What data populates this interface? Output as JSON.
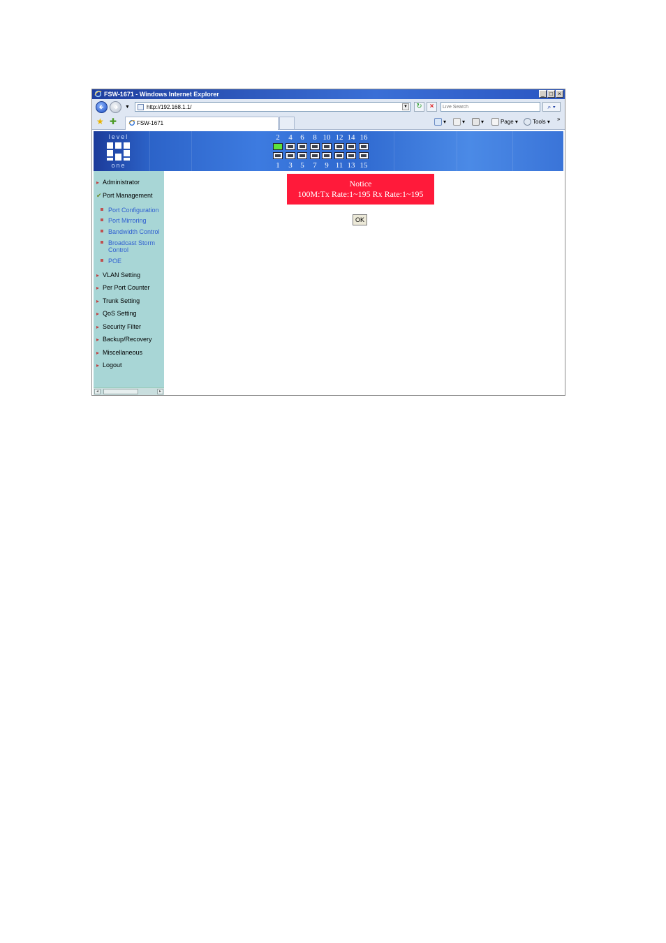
{
  "window": {
    "title": "FSW-1671 - Windows Internet Explorer",
    "minimize": "_",
    "maximize": "□",
    "close": "×"
  },
  "address_bar": {
    "url": "http://192.168.1.1/",
    "search_placeholder": "Live Search"
  },
  "tab": {
    "label": "FSW-1671"
  },
  "command_bar": {
    "page_label": "Page",
    "tools_label": "Tools",
    "more": "»"
  },
  "banner": {
    "logo_top": "level",
    "logo_bottom": "one",
    "top_port_numbers": [
      "2",
      "4",
      "6",
      "8",
      "10",
      "12",
      "14",
      "16"
    ],
    "bottom_port_numbers": [
      "1",
      "3",
      "5",
      "7",
      "9",
      "11",
      "13",
      "15"
    ],
    "active_port": "2"
  },
  "sidebar": {
    "items": [
      {
        "label": "Administrator"
      },
      {
        "label": "Port Management"
      },
      {
        "label": "VLAN Setting"
      },
      {
        "label": "Per Port Counter"
      },
      {
        "label": "Trunk Setting"
      },
      {
        "label": "QoS Setting"
      },
      {
        "label": "Security Filter"
      },
      {
        "label": "Backup/Recovery"
      },
      {
        "label": "Miscellaneous"
      },
      {
        "label": "Logout"
      }
    ],
    "subitems": [
      {
        "label": "Port Configuration"
      },
      {
        "label": "Port Mirroring"
      },
      {
        "label": "Bandwidth Control"
      },
      {
        "label": "Broadcast Storm Control"
      },
      {
        "label": "POE"
      }
    ]
  },
  "notice": {
    "title": "Notice",
    "message": "100M:Tx Rate:1~195 Rx Rate:1~195"
  },
  "ok_button": {
    "label": "OK"
  }
}
